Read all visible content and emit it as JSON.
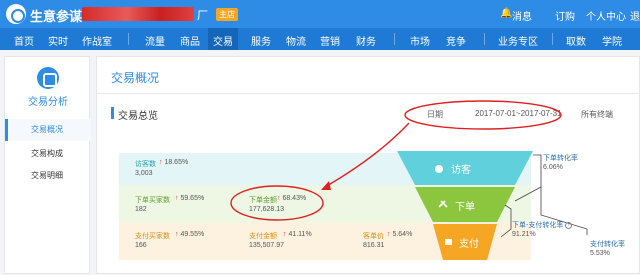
{
  "header": {
    "brand": "生意参谋",
    "shop_suffix": "厂",
    "shop_badge": "主店",
    "messages": "消息",
    "subscribe": "订购",
    "personal_center": "个人中心",
    "exit": "退"
  },
  "nav": {
    "items": [
      "首页",
      "实时",
      "作战室",
      "流量",
      "商品",
      "交易",
      "服务",
      "物流",
      "营销",
      "财务",
      "市场",
      "竞争",
      "业务专区",
      "取数",
      "学院"
    ],
    "active": "交易"
  },
  "sidebar": {
    "title": "交易分析",
    "items": [
      {
        "label": "交易概况",
        "active": true
      },
      {
        "label": "交易构成",
        "active": false
      },
      {
        "label": "交易明细",
        "active": false
      }
    ]
  },
  "main": {
    "title": "交易概况",
    "section_title": "交易总览",
    "date_label": "日期",
    "date_range": "2017-07-01~2017-07-31",
    "terminal": "所有终端"
  },
  "metrics": {
    "visitors": {
      "label": "访客数",
      "change": "18.65%",
      "value": "3,003"
    },
    "order_buyers": {
      "label": "下单买家数",
      "change": "59.65%",
      "value": "182"
    },
    "order_amount": {
      "label": "下单金额",
      "change": "68.43%",
      "value": "177,628.13"
    },
    "pay_buyers": {
      "label": "支付买家数",
      "change": "49.55%",
      "value": "166"
    },
    "pay_amount": {
      "label": "支付金额",
      "change": "41.11%",
      "value": "135,507.97"
    },
    "unit_price": {
      "label": "客单价",
      "change": "5.64%",
      "value": "816.31"
    }
  },
  "funnel": {
    "stage1": "访客",
    "stage2": "下单",
    "stage3": "支付"
  },
  "conversions": {
    "order_conv": {
      "label": "下单转化率",
      "value": "6.06%"
    },
    "order_pay_conv": {
      "label": "下单-支付转化率",
      "value": "91.21%"
    },
    "pay_conv": {
      "label": "支付转化率",
      "value": "5.53%"
    }
  },
  "colors": {
    "primary": "#2e8be6",
    "cyan": "#5fd0dc",
    "green": "#8cc63f",
    "orange": "#f5a623",
    "annotation_red": "#e02020"
  }
}
